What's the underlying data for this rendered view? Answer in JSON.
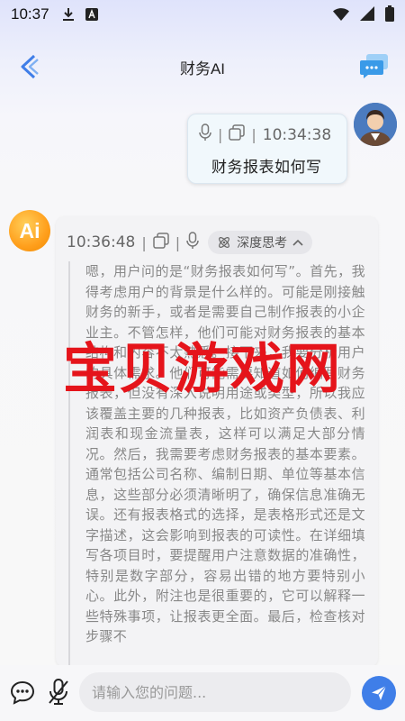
{
  "status_bar": {
    "time": "10:37",
    "icons": [
      "download-icon",
      "app-a-icon",
      "wifi-icon",
      "signal-icon",
      "battery-icon"
    ]
  },
  "header": {
    "title": "财务AI",
    "back_icon": "chevron-left-icon",
    "right_icon": "chat-bubbles-icon"
  },
  "user_message": {
    "time": "10:34:38",
    "text": "财务报表如何写",
    "icons": [
      "mic-icon",
      "copy-icon"
    ]
  },
  "ai_message": {
    "avatar_text": "Ai",
    "time": "10:36:48",
    "think_label": "深度思考",
    "icons": [
      "copy-icon",
      "mic-icon",
      "atom-icon",
      "chevron-up-icon"
    ],
    "thinking_text": "嗯，用户问的是“财务报表如何写”。首先，我得考虑用户的背景是什么样的。可能是刚接触财务的新手，或者是需要自己制作报表的小企业主。不管怎样，他们可能对财务报表的基本结构和内容不太熟悉。接下来，我要分析用户的具体需求。他们可能需要知道如何编写财务报表，但没有深入说明用途或类型，所以我应该覆盖主要的几种报表，比如资产负债表、利润表和现金流量表，这样可以满足大部分情况。然后，我需要考虑财务报表的基本要素。通常包括公司名称、编制日期、单位等基本信息，这些部分必须清晰明了，确保信息准确无误。还有报表格式的选择，是表格形式还是文字描述，这会影响到报表的可读性。在详细填写各项目时，要提醒用户注意数据的准确性，特别是数字部分，容易出错的地方要特别小心。此外，附注也是很重要的，它可以解释一些特殊事项，让报表更全面。最后，检查核对步骤不"
  },
  "watermark": "宝贝游戏网",
  "bottom_bar": {
    "input_placeholder": "请输入您的问题...",
    "icons": [
      "chat-dots-icon",
      "mic-off-icon",
      "send-icon"
    ]
  },
  "colors": {
    "accent_blue": "#3f7ee8",
    "watermark_red": "#e5141b",
    "ai_avatar_orange": "#ff9f1c"
  }
}
